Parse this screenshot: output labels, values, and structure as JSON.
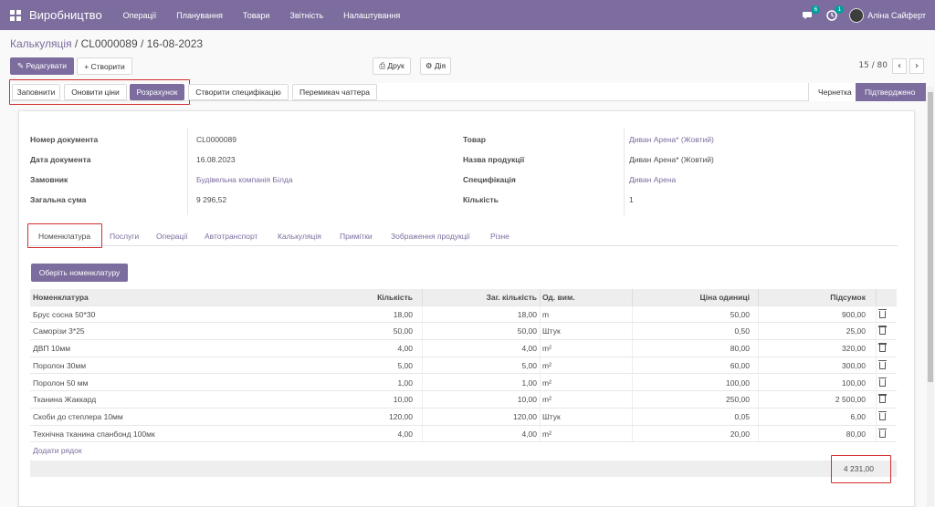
{
  "app": {
    "brand": "Виробництво",
    "menu": [
      "Операції",
      "Планування",
      "Товари",
      "Звітність",
      "Налаштування"
    ],
    "chat_badge": "6",
    "activity_badge": "1",
    "user_name": "Аліна Сайферт"
  },
  "breadcrumb": {
    "parent": "Калькуляція",
    "separator": " / ",
    "current": "CL0000089 / 16-08-2023"
  },
  "toolbar": {
    "edit_label": "✎ Редагувати",
    "create_label": "+ Створити",
    "print_label": "⎙ Друк",
    "action_label": "⚙ Дія",
    "pager": "15 / 80"
  },
  "statusbar": {
    "buttons": [
      "Заповнити",
      "Оновити ціни",
      "Розрахунок",
      "Створити специфікацію",
      "Перемикач чаттера"
    ],
    "stages": [
      "Чернетка",
      "Підтверджено"
    ]
  },
  "form": {
    "left": [
      {
        "label": "Номер документа",
        "value": "CL0000089"
      },
      {
        "label": "Дата документа",
        "value": "16.08.2023"
      },
      {
        "label": "Замовник",
        "value": "Будівельна компанія Білда"
      },
      {
        "label": "Загальна сума",
        "value": "9 296,52"
      }
    ],
    "right": [
      {
        "label": "Товар",
        "value": "Диван Арена* (Жовтий)"
      },
      {
        "label": "Назва продукції",
        "value": "Диван Арена* (Жовтий)"
      },
      {
        "label": "Специфікація",
        "value": "Диван Арена"
      },
      {
        "label": "Кількість",
        "value": "1"
      }
    ]
  },
  "tabs": [
    "Номенклатура",
    "Послуги",
    "Операції",
    "Автотранспорт",
    "Калькуляція",
    "Примітки",
    "Зображення продукції",
    "Різне"
  ],
  "table": {
    "select_button": "Оберіть номенклатуру",
    "columns": [
      "Номенклатура",
      "Кількість",
      "Заг. кількість",
      "Од. вим.",
      "Ціна одиниці",
      "Підсумок"
    ],
    "rows": [
      [
        "Брус сосна 50*30",
        "18,00",
        "18,00",
        "m",
        "50,00",
        "900,00"
      ],
      [
        "Саморізи 3*25",
        "50,00",
        "50,00",
        "Штук",
        "0,50",
        "25,00"
      ],
      [
        "ДВП 10мм",
        "4,00",
        "4,00",
        "m²",
        "80,00",
        "320,00"
      ],
      [
        "Поролон 30мм",
        "5,00",
        "5,00",
        "m²",
        "60,00",
        "300,00"
      ],
      [
        "Поролон 50 мм",
        "1,00",
        "1,00",
        "m²",
        "100,00",
        "100,00"
      ],
      [
        "Тканина Жаккард",
        "10,00",
        "10,00",
        "m²",
        "250,00",
        "2 500,00"
      ],
      [
        "Скоби до степлера 10мм",
        "120,00",
        "120,00",
        "Штук",
        "0,05",
        "6,00"
      ],
      [
        "Технічна тканина спанбонд 100мк",
        "4,00",
        "4,00",
        "m²",
        "20,00",
        "80,00"
      ]
    ],
    "add_line": "Додати рядок",
    "total": "4 231,00"
  }
}
